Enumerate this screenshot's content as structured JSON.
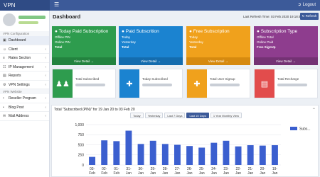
{
  "app": {
    "brand": "VPN",
    "logout_label": "Logout"
  },
  "icons": {
    "hamburger": "menu-icon",
    "logout": "logout-icon",
    "refresh": "refresh-icon"
  },
  "sidebar": {
    "section1": "VPN Configuration",
    "items": [
      {
        "label": "Dashboard",
        "icon": "▣",
        "caret": ""
      },
      {
        "label": "Client",
        "icon": "☺",
        "caret": "‹"
      },
      {
        "label": "Rates Section",
        "icon": "≡",
        "caret": "‹"
      },
      {
        "label": "IP Management",
        "icon": "☷",
        "caret": "‹"
      },
      {
        "label": "Reports",
        "icon": "▤",
        "caret": "‹"
      },
      {
        "label": "VPN Settings",
        "icon": "⚙",
        "caret": "‹"
      }
    ],
    "section2": "VPN Website",
    "items2": [
      {
        "label": "Reseller Program",
        "icon": "•",
        "caret": "‹"
      },
      {
        "label": "Blog Post",
        "icon": "•",
        "caret": "‹"
      },
      {
        "label": "Mail Address",
        "icon": "✉",
        "caret": "‹"
      }
    ]
  },
  "header": {
    "title": "Dashboard",
    "refresh_text": "Last Refresh Time: 03 Feb 2020 19:18:45",
    "refresh_button": "Refresh"
  },
  "cards": [
    {
      "title": "Today Paid Subscription",
      "lines": [
        "Offline PIN",
        "Online PIN",
        "Total"
      ],
      "footer": "View Detail →",
      "color": "#2e9c4e",
      "footer_color": "#23833f"
    },
    {
      "title": "Paid Subscrition",
      "lines": [
        "Today",
        "Yesterday",
        "Total"
      ],
      "footer": "View Detail →",
      "color": "#1b83d0",
      "footer_color": "#146cae"
    },
    {
      "title": "Free Subscription",
      "lines": [
        "Today",
        "Yesterday",
        "Total"
      ],
      "footer": "View Detail →",
      "color": "#f0a11c",
      "footer_color": "#d68a10"
    },
    {
      "title": "Subscription Type",
      "lines": [
        "Offline Total",
        "Online Paid",
        "Free SignUp"
      ],
      "footer": "View Detail →",
      "color": "#8e3d8e",
      "footer_color": "#743274"
    }
  ],
  "mini_cards": [
    {
      "label": "Total Subscribed",
      "icon": "♟♟",
      "color": "#2e9c4e"
    },
    {
      "label": "Today Subscribed",
      "icon": "✚",
      "color": "#1b83d0"
    },
    {
      "label": "Total User Signup",
      "icon": "✚",
      "color": "#f0a11c"
    },
    {
      "label": "Total Recharge",
      "icon": "▤",
      "color": "#e24c4c"
    }
  ],
  "chart_panel": {
    "title": "Total \"Subscribed (PIN)\" for 19 Jan 20 to 03 Feb 20",
    "collapse": "−",
    "tabs": [
      "Today",
      "Yesterday",
      "Last 7 Days",
      "Last 15 Days",
      "1 Year Monthly View"
    ],
    "active_tab": 3
  },
  "chart_data": {
    "type": "bar",
    "categories": [
      "03-Feb",
      "02-Feb",
      "01-Feb",
      "31-Jan",
      "30-Jan",
      "29-Jan",
      "28-Jan",
      "27-Jan",
      "26-Jan",
      "25-Jan",
      "24-Jan",
      "23-Jan",
      "22-Jan",
      "21-Jan",
      "20-Jan",
      "19-Jan"
    ],
    "x_tick_top": [
      "03-",
      "02-",
      "01-",
      "31-",
      "30-",
      "29-",
      "28-",
      "27-",
      "26-",
      "25-",
      "24-",
      "23-",
      "22-",
      "21-",
      "20-",
      "19-"
    ],
    "x_tick_bottom": [
      "Feb",
      "Feb",
      "Feb",
      "Jan",
      "Jan",
      "Jan",
      "Jan",
      "Jan",
      "Jan",
      "Jan",
      "Jan",
      "Jan",
      "Jan",
      "Jan",
      "Jan",
      "Jan"
    ],
    "series": [
      {
        "name": "Subs...",
        "values": [
          200,
          610,
          590,
          850,
          520,
          600,
          520,
          500,
          470,
          430,
          550,
          600,
          460,
          490,
          480,
          490
        ],
        "color": "#3b5fcf"
      }
    ],
    "yticks": [
      "0",
      "250",
      "500",
      "750",
      "1,000"
    ],
    "ylim": [
      0,
      1000
    ],
    "grid": true,
    "legend_position": "top-right"
  }
}
